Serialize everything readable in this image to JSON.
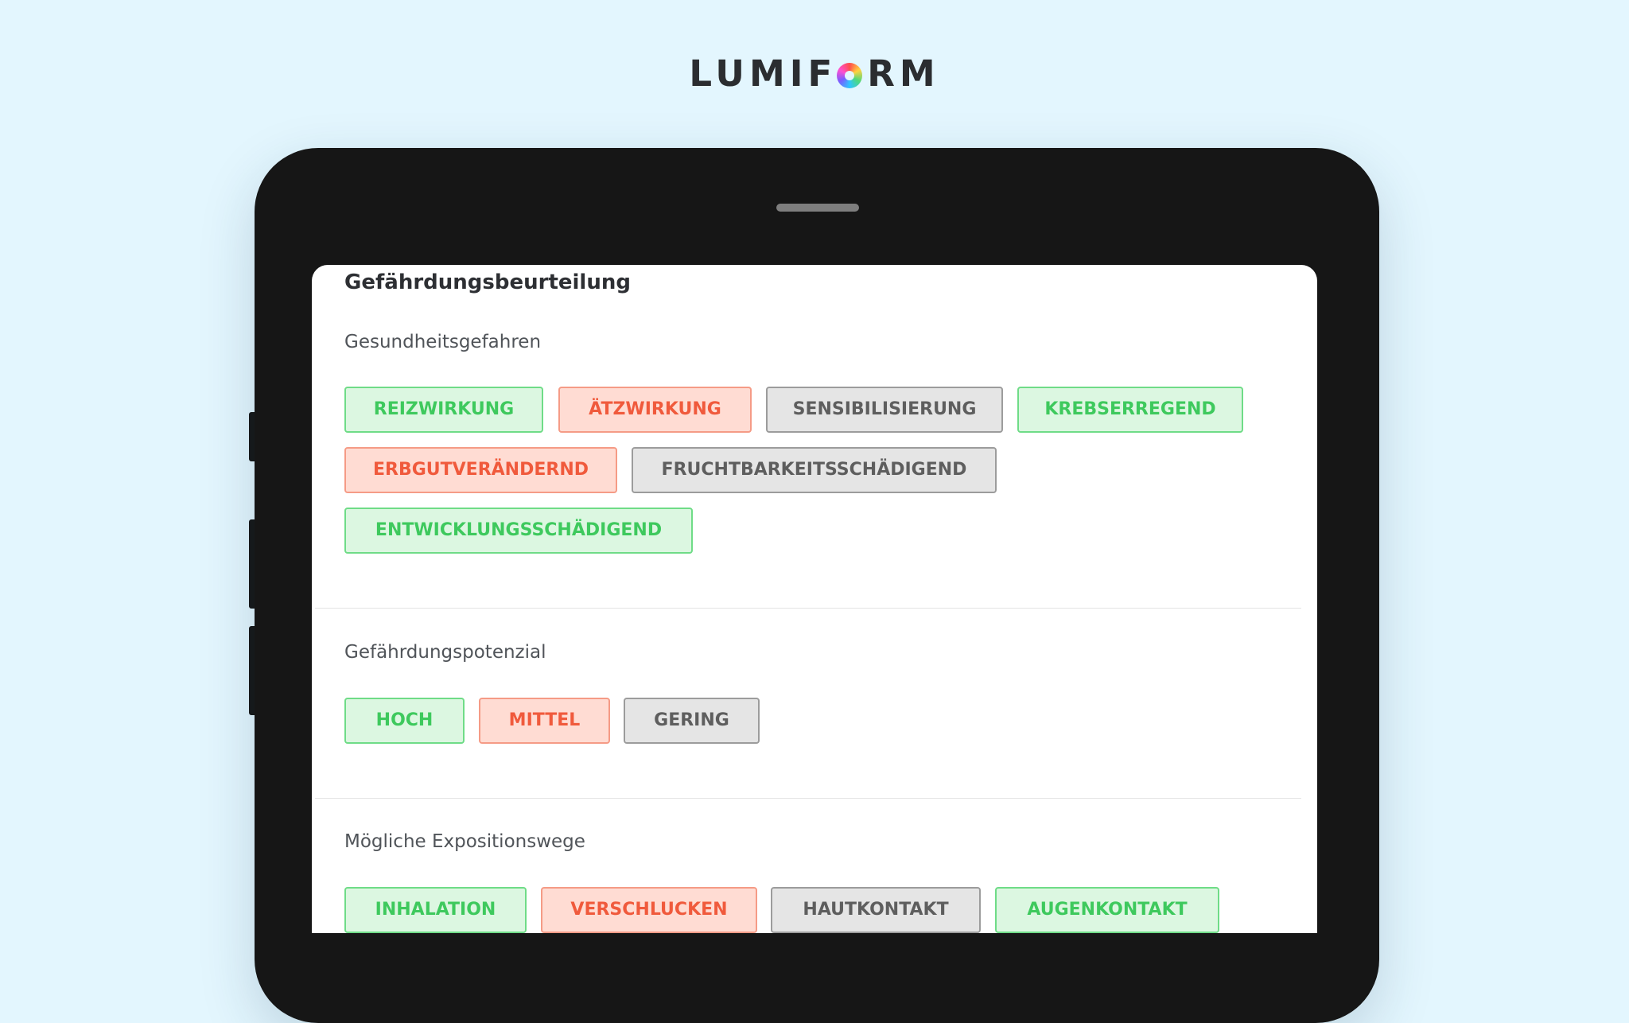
{
  "brand": {
    "prefix": "LUMIF",
    "logo_icon": "rainbow-ring-o",
    "suffix": "RM"
  },
  "form": {
    "title": "Gefährdungsbeurteilung",
    "sections": [
      {
        "label": "Gesundheitsgefahren",
        "chips": [
          {
            "label": "REIZWIRKUNG",
            "variant": "green"
          },
          {
            "label": "ÄTZWIRKUNG",
            "variant": "red"
          },
          {
            "label": "SENSIBILISIERUNG",
            "variant": "gray"
          },
          {
            "label": "KREBSERREGEND",
            "variant": "green"
          },
          {
            "label": "ERBGUTVERÄNDERND",
            "variant": "red"
          },
          {
            "label": "FRUCHTBARKEITSSCHÄDIGEND",
            "variant": "gray"
          },
          {
            "label": "ENTWICKLUNGSSCHÄDIGEND",
            "variant": "green"
          }
        ]
      },
      {
        "label": "Gefährdungspotenzial",
        "chips": [
          {
            "label": "HOCH",
            "variant": "green"
          },
          {
            "label": "MITTEL",
            "variant": "red"
          },
          {
            "label": "GERING",
            "variant": "gray"
          }
        ]
      },
      {
        "label": "Mögliche Expositionswege",
        "chips": [
          {
            "label": "INHALATION",
            "variant": "green"
          },
          {
            "label": "VERSCHLUCKEN",
            "variant": "red"
          },
          {
            "label": "HAUTKONTAKT",
            "variant": "gray"
          },
          {
            "label": "AUGENKONTAKT",
            "variant": "green"
          }
        ]
      }
    ]
  },
  "colors": {
    "background": "#e3f6fe",
    "device": "#161616",
    "green_text": "#3ec95d",
    "red_text": "#f05a3c",
    "gray_text": "#5e5e5e"
  }
}
